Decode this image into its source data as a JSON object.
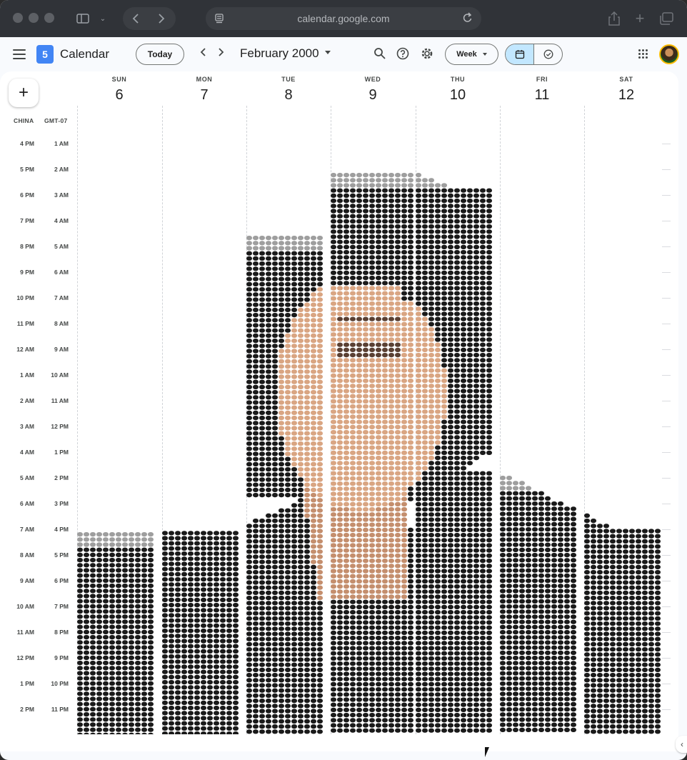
{
  "browser": {
    "url": "calendar.google.com"
  },
  "header": {
    "logo_text": "5",
    "app_title": "Calendar",
    "today_label": "Today",
    "prev_icon": "chevron-left-icon",
    "next_icon": "chevron-right-icon",
    "month_label": "February 2000",
    "view_label": "Week"
  },
  "create_label": "+",
  "timezones": {
    "left": "CHINA",
    "right": "GMT-07"
  },
  "days": [
    {
      "name": "SUN",
      "num": "6"
    },
    {
      "name": "MON",
      "num": "7"
    },
    {
      "name": "TUE",
      "num": "8"
    },
    {
      "name": "WED",
      "num": "9"
    },
    {
      "name": "THU",
      "num": "10"
    },
    {
      "name": "FRI",
      "num": "11"
    },
    {
      "name": "SAT",
      "num": "12"
    }
  ],
  "hours_china": [
    "4 PM",
    "5 PM",
    "6 PM",
    "7 PM",
    "8 PM",
    "9 PM",
    "10 PM",
    "11 PM",
    "12 AM",
    "1 AM",
    "2 AM",
    "3 AM",
    "4 AM",
    "5 AM",
    "6 AM",
    "7 AM",
    "8 AM",
    "9 AM",
    "10 AM",
    "11 AM",
    "12 PM",
    "1 PM",
    "2 PM"
  ],
  "hours_local": [
    "1 AM",
    "2 AM",
    "3 AM",
    "4 AM",
    "5 AM",
    "6 AM",
    "7 AM",
    "8 AM",
    "9 AM",
    "10 AM",
    "11 AM",
    "12 PM",
    "1 PM",
    "2 PM",
    "3 PM",
    "4 PM",
    "5 PM",
    "6 PM",
    "7 PM",
    "8 PM",
    "9 PM",
    "10 PM",
    "11 PM"
  ],
  "colors": {
    "accent": "#c2e7ff",
    "brand_blue": "#4285f4",
    "chrome": "#303338",
    "portrait_dark": "#1a1a1a",
    "portrait_skin": "#d9a582"
  },
  "icons": [
    "sidebar-icon",
    "share-icon",
    "new-tab-icon",
    "tabs-icon",
    "reload-icon",
    "search-icon",
    "help-icon",
    "settings-icon",
    "calendar-icon",
    "tasks-icon",
    "apps-grid-icon"
  ]
}
